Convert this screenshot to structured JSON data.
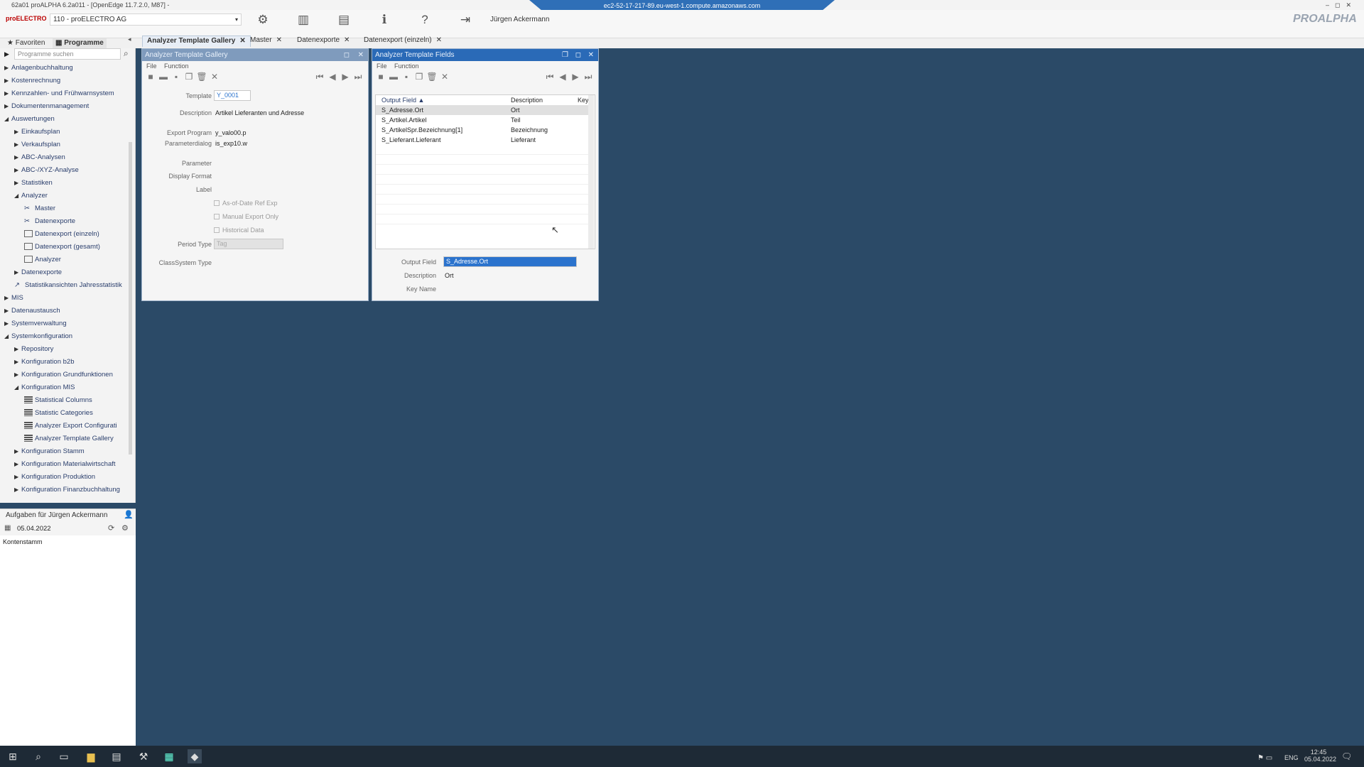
{
  "window": {
    "title": "62a01 proALPHA 6.2a011 - [OpenEdge 11.7.2.0, M87] -",
    "remote_host": "ec2-52-17-217-89.eu-west-1.compute.amazonaws.com"
  },
  "toolbar": {
    "logo": "proELECTRO",
    "company": "110 - proELECTRO AG",
    "user": "Jürgen Ackermann",
    "brand": "PROALPHA"
  },
  "nav": {
    "tab_favorites": "Favoriten",
    "tab_programs": "Programme",
    "search_placeholder": "Programme suchen"
  },
  "tabs": [
    {
      "label": "Analyzer Template Gallery"
    },
    {
      "label": "Master"
    },
    {
      "label": "Datenexporte"
    },
    {
      "label": "Datenexport (einzeln)"
    }
  ],
  "tree": [
    {
      "label": "Anlagenbuchhaltung",
      "level": 0,
      "expanded": false
    },
    {
      "label": "Kostenrechnung",
      "level": 0,
      "expanded": false
    },
    {
      "label": "Kennzahlen- und Frühwarnsystem",
      "level": 0,
      "expanded": false
    },
    {
      "label": "Dokumentenmanagement",
      "level": 0,
      "expanded": false
    },
    {
      "label": "Auswertungen",
      "level": 0,
      "expanded": true
    },
    {
      "label": "Einkaufsplan",
      "level": 1,
      "expanded": false
    },
    {
      "label": "Verkaufsplan",
      "level": 1,
      "expanded": false
    },
    {
      "label": "ABC-Analysen",
      "level": 1,
      "expanded": false
    },
    {
      "label": "ABC-/XYZ-Analyse",
      "level": 1,
      "expanded": false
    },
    {
      "label": "Statistiken",
      "level": 1,
      "expanded": false
    },
    {
      "label": "Analyzer",
      "level": 1,
      "expanded": true
    },
    {
      "label": "Master",
      "level": 2,
      "icon": "tools"
    },
    {
      "label": "Datenexporte",
      "level": 2,
      "icon": "tools"
    },
    {
      "label": "Datenexport (einzeln)",
      "level": 2,
      "icon": "window"
    },
    {
      "label": "Datenexport (gesamt)",
      "level": 2,
      "icon": "window"
    },
    {
      "label": "Analyzer",
      "level": 2,
      "icon": "window"
    },
    {
      "label": "Datenexporte",
      "level": 1,
      "expanded": false
    },
    {
      "label": "Statistikansichten Jahresstatistik",
      "level": 1,
      "icon": "chart"
    },
    {
      "label": "MIS",
      "level": 0,
      "expanded": false
    },
    {
      "label": "Datenaustausch",
      "level": 0,
      "expanded": false
    },
    {
      "label": "Systemverwaltung",
      "level": 0,
      "expanded": false
    },
    {
      "label": "Systemkonfiguration",
      "level": 0,
      "expanded": true
    },
    {
      "label": "Repository",
      "level": 1,
      "expanded": false
    },
    {
      "label": "Konfiguration b2b",
      "level": 1,
      "expanded": false
    },
    {
      "label": "Konfiguration Grundfunktionen",
      "level": 1,
      "expanded": false
    },
    {
      "label": "Konfiguration MIS",
      "level": 1,
      "expanded": true
    },
    {
      "label": "Statistical Columns",
      "level": 2,
      "icon": "table"
    },
    {
      "label": "Statistic Categories",
      "level": 2,
      "icon": "table"
    },
    {
      "label": "Analyzer Export Configurati",
      "level": 2,
      "icon": "table"
    },
    {
      "label": "Analyzer Template Gallery",
      "level": 2,
      "icon": "table"
    },
    {
      "label": "Konfiguration Stamm",
      "level": 1,
      "expanded": false
    },
    {
      "label": "Konfiguration Materialwirtschaft",
      "level": 1,
      "expanded": false
    },
    {
      "label": "Konfiguration Produktion",
      "level": 1,
      "expanded": false
    },
    {
      "label": "Konfiguration Finanzbuchhaltung",
      "level": 1,
      "expanded": false
    }
  ],
  "tasks": {
    "title": "Aufgaben für Jürgen Ackermann",
    "date": "05.04.2022",
    "item": "Kontenstamm"
  },
  "gallery": {
    "title": "Analyzer Template Gallery",
    "menu_file": "File",
    "menu_function": "Function",
    "template_label": "Template",
    "template_value": "Y_0001",
    "description_label": "Description",
    "description_value": "Artikel Lieferanten und Adresse",
    "export_program_label": "Export Program",
    "export_program_value": "y_valo00.p",
    "parameter_dialog_label": "Parameterdialog",
    "parameter_dialog_value": "is_exp10.w",
    "parameter_label": "Parameter",
    "display_format_label": "Display Format",
    "label_label": "Label",
    "check_asof": "As-of-Date Ref Exp",
    "check_manual": "Manual Export Only",
    "check_historical": "Historical Data",
    "period_type_label": "Period Type",
    "period_type_value": "Tag",
    "class_system_label": "ClassSystem Type"
  },
  "fields": {
    "title": "Analyzer Template Fields",
    "menu_file": "File",
    "menu_function": "Function",
    "col_output": "Output Field",
    "col_desc": "Description",
    "col_key": "Key I",
    "rows": [
      {
        "output": "S_Adresse.Ort",
        "desc": "Ort"
      },
      {
        "output": "S_Artikel.Artikel",
        "desc": "Teil"
      },
      {
        "output": "S_ArtikelSpr.Bezeichnung[1]",
        "desc": "Bezeichnung"
      },
      {
        "output": "S_Lieferant.Lieferant",
        "desc": "Lieferant"
      }
    ],
    "output_field_label": "Output Field",
    "output_field_value": "S_Adresse.Ort",
    "description_label": "Description",
    "description_value": "Ort",
    "key_name_label": "Key Name"
  },
  "taskbar": {
    "lang": "ENG",
    "time": "12:45",
    "date": "05.04.2022"
  },
  "colors": {
    "desktop": "#2b4a67",
    "active_title": "#2a6ab7",
    "selection": "#2b73cd"
  }
}
